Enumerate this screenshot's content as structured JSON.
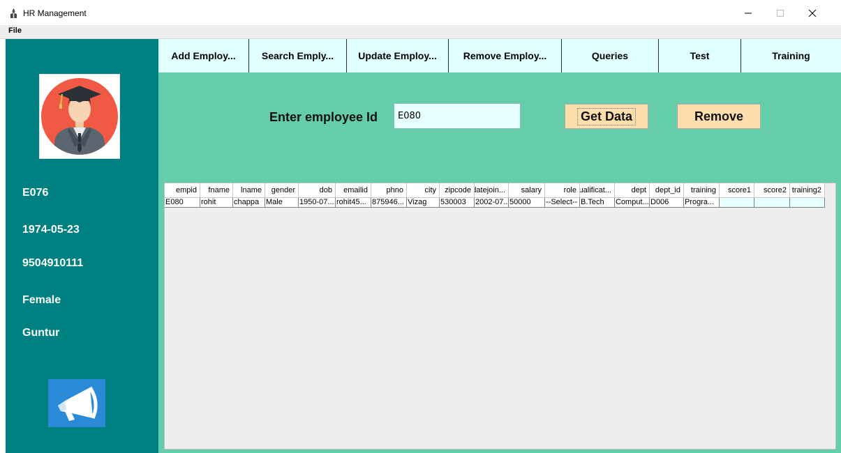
{
  "window": {
    "title": "HR Management",
    "menu": [
      "File"
    ]
  },
  "sidebar": {
    "empid": "E076",
    "dob": "1974-05-23",
    "phone": "9504910111",
    "gender": "Female",
    "city": "Guntur"
  },
  "tabs": [
    "Add Employ...",
    "Search Emply...",
    "Update Employ...",
    "Remove Employ...",
    "Queries",
    "Test",
    "Training"
  ],
  "form": {
    "label": "Enter employee Id",
    "empid_value": "E080",
    "get_data_label": "Get Data",
    "remove_label": "Remove"
  },
  "table": {
    "columns": [
      "empid",
      "fname",
      "lname",
      "gender",
      "dob",
      "emailid",
      "phno",
      "city",
      "zipcode",
      "datejoin...",
      "salary",
      "role",
      "qualificat...",
      "dept",
      "dept_id",
      "training",
      "score1",
      "score2",
      "training2"
    ],
    "rows": [
      [
        "E080",
        "rohit",
        "chappa",
        "Male",
        "1950-07...",
        "rohit45...",
        "875946...",
        "Vizag",
        "530003",
        "2002-07...",
        "50000",
        "--Select--",
        "B.Tech",
        "Comput...",
        "D006",
        "Progra...",
        "",
        "",
        ""
      ]
    ]
  },
  "colors": {
    "sidebar": "#008080",
    "main": "#66cdaa",
    "tab": "#e0ffff",
    "button": "#ffdead",
    "table_bg": "#eeeeee"
  }
}
